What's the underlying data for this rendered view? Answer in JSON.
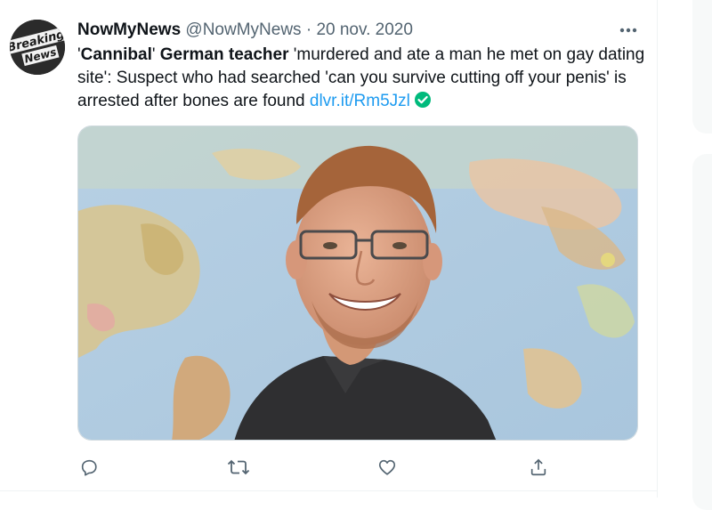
{
  "tweet": {
    "author_name": "NowMyNews",
    "handle": "@NowMyNews",
    "separator": "·",
    "date": "20 nov. 2020",
    "text_parts": {
      "q1": "'",
      "bold1": "Cannibal",
      "q2": "' ",
      "bold2": "German teacher",
      "rest": " 'murdered and ate a man he met on gay dating site': Suspect who had searched 'can you survive cutting off your penis' is arrested after bones are found "
    },
    "link_text": "dlvr.it/Rm5Jzl",
    "avatar_logo_text": [
      "Breaking",
      "News"
    ],
    "media_alt": "Photo of smiling man with glasses in front of a world map"
  },
  "actions": {
    "reply_icon": "reply-icon",
    "retweet_icon": "retweet-icon",
    "like_icon": "like-icon",
    "share_icon": "share-icon"
  },
  "colors": {
    "link": "#1d9bf0",
    "verified": "#00ba7c",
    "secondary_text": "#536471",
    "icon": "#536471"
  }
}
